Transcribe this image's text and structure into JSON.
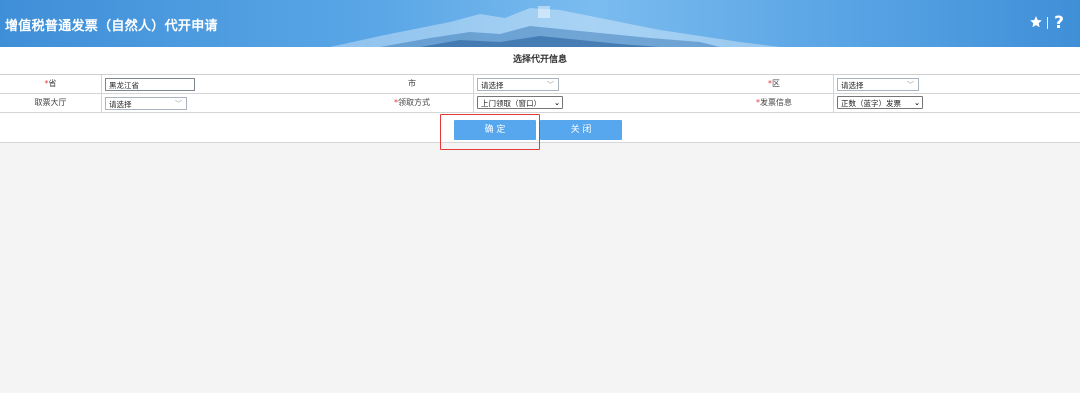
{
  "header": {
    "title": "增值税普通发票（自然人）代开申请",
    "star_icon": "star-icon",
    "help_icon": "question-icon",
    "help_text": "?"
  },
  "form": {
    "section_title": "选择代开信息",
    "province": {
      "required": "*",
      "label": "省",
      "value": "黑龙江省"
    },
    "city": {
      "label": "市",
      "value": "请选择"
    },
    "district": {
      "required": "*",
      "label": "区",
      "value": "请选择"
    },
    "hall": {
      "label": "取票大厅",
      "value": "请选择"
    },
    "pickup": {
      "required": "*",
      "label": "领取方式",
      "value": "上门领取（窗口）"
    },
    "invoice": {
      "required": "*",
      "label": "发票信息",
      "value": "正数（蓝字）发票"
    }
  },
  "buttons": {
    "confirm": "确 定",
    "close": "关 闭"
  },
  "colors": {
    "header": "#4a9be0",
    "button": "#57a7ef",
    "required": "#e53935",
    "highlight": "#e53935"
  }
}
